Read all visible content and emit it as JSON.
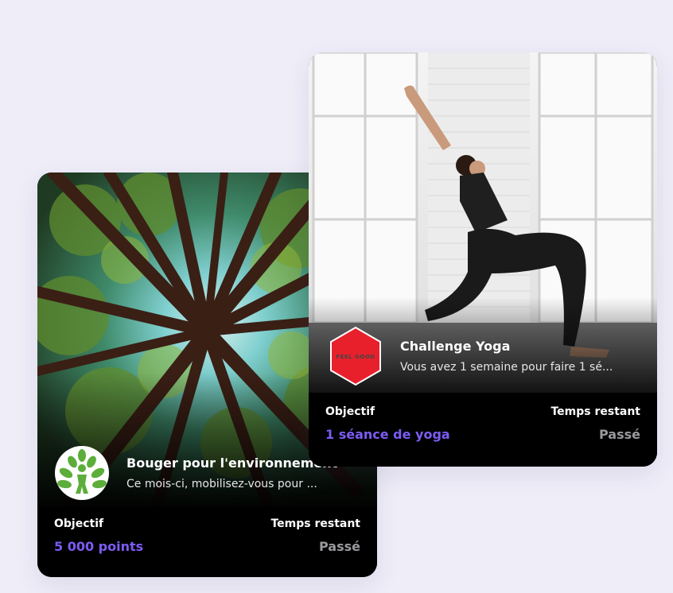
{
  "cards": [
    {
      "title": "Bouger pour l'environnement",
      "description": "Ce mois-ci, mobilisez-vous pour ...",
      "objective_label": "Objectif",
      "objective_value": "5 000 points",
      "time_label": "Temps restant",
      "time_value": "Passé",
      "logo_icon": "tree-person-icon",
      "photo": "forest-canopy-image"
    },
    {
      "title": "Challenge Yoga",
      "description": "Vous avez 1 semaine pour faire 1 sé...",
      "objective_label": "Objectif",
      "objective_value": "1 séance de yoga",
      "time_label": "Temps restant",
      "time_value": "Passé",
      "logo_icon": "feel-good-badge-icon",
      "logo_text": "FEEL GOOD",
      "photo": "yoga-pose-image"
    }
  ],
  "colors": {
    "background": "#efedf8",
    "accent": "#7c5cf5",
    "muted": "#9a9a9e",
    "badge_red": "#e8202c",
    "logo_green": "#5cae3a"
  }
}
